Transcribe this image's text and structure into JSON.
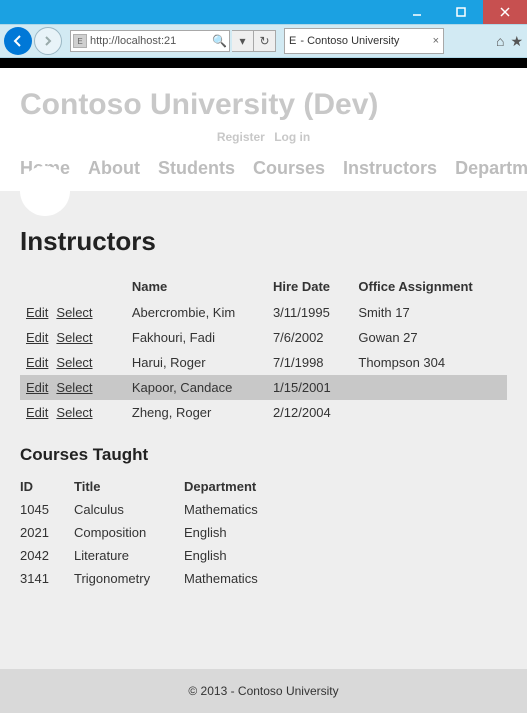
{
  "window": {
    "address_prefix": "http://",
    "address_host": "localhost:21",
    "tab_title": " - Contoso University"
  },
  "header": {
    "title": "Contoso University  (Dev)",
    "register": "Register",
    "login": "Log in",
    "nav": [
      "Home",
      "About",
      "Students",
      "Courses",
      "Instructors",
      "Departments"
    ]
  },
  "page": {
    "title": "Instructors",
    "instructors": {
      "headers": {
        "name": "Name",
        "hire": "Hire Date",
        "office": "Office Assignment"
      },
      "actions": {
        "edit": "Edit",
        "select": "Select"
      },
      "rows": [
        {
          "name": "Abercrombie, Kim",
          "hire": "3/11/1995",
          "office": "Smith 17",
          "selected": false
        },
        {
          "name": "Fakhouri, Fadi",
          "hire": "7/6/2002",
          "office": "Gowan 27",
          "selected": false
        },
        {
          "name": "Harui, Roger",
          "hire": "7/1/1998",
          "office": "Thompson 304",
          "selected": false
        },
        {
          "name": "Kapoor, Candace",
          "hire": "1/15/2001",
          "office": "",
          "selected": true
        },
        {
          "name": "Zheng, Roger",
          "hire": "2/12/2004",
          "office": "",
          "selected": false
        }
      ]
    },
    "courses_title": "Courses Taught",
    "courses": {
      "headers": {
        "id": "ID",
        "title": "Title",
        "dept": "Department"
      },
      "rows": [
        {
          "id": "1045",
          "title": "Calculus",
          "dept": "Mathematics"
        },
        {
          "id": "2021",
          "title": "Composition",
          "dept": "English"
        },
        {
          "id": "2042",
          "title": "Literature",
          "dept": "English"
        },
        {
          "id": "3141",
          "title": "Trigonometry",
          "dept": "Mathematics"
        }
      ]
    }
  },
  "footer": "© 2013 - Contoso University"
}
